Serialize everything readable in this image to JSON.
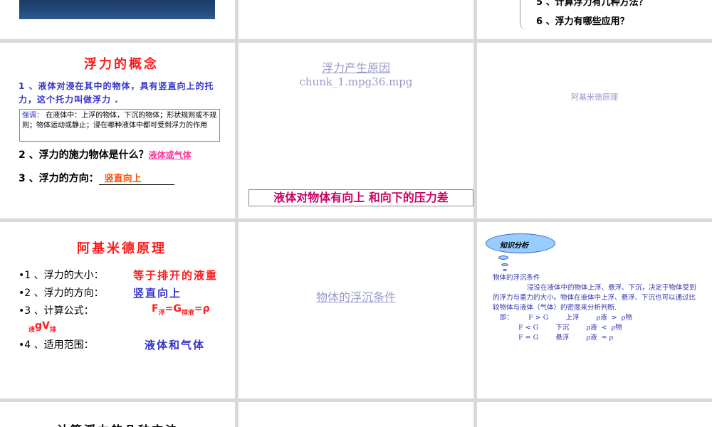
{
  "slide_top_right": {
    "q5": "5 、计算浮力有几种方法？",
    "q6": "6 、浮力有哪些应用？"
  },
  "slide_concept": {
    "title": "浮力的概念",
    "definition": "1 、液体对浸在其中的物体，具有竖直向上的托力，这个托力叫做浮力 .",
    "emphasis_tag": "强调：",
    "emphasis_text": "在液体中：上浮的物体，下沉的物体；形状规则或不规则；物体运动或静止；浸在哪种液体中都可受到浮力的作用",
    "q2": "2 、浮力的施力物体是什么？",
    "a2": "液体或气体",
    "q3": "3 、浮力的方向：",
    "a3": "竖直向上"
  },
  "slide_cause": {
    "link_title": "浮力产生原因",
    "link_file": "chunk_1.mpg36.mpg",
    "conclusion": "液体对物体有向上 和向下的压力差"
  },
  "slide_archimedes_link": {
    "link": "阿基米德原理"
  },
  "slide_archimedes": {
    "title": "阿基米德原理",
    "b1": "•1 、浮力的大小：",
    "a1": "等于排开的液重",
    "b2": "•2 、浮力的方向：",
    "a2": "竖直向上",
    "b3": "•3 、计算公式：",
    "formula_F": "F",
    "formula_sub_float": "浮",
    "formula_eq_G": "=G",
    "formula_sub_disp": "排液",
    "formula_eq_rho": "=ρ",
    "formula_sub_liquid": "液",
    "formula_gV": "gV",
    "formula_sub_pai": "排",
    "b4": "•4 、适用范围：",
    "a4": "液体和气体"
  },
  "slide_float_sink": {
    "link": "物体的浮沉条件"
  },
  "slide_knowledge": {
    "cloud_label": "知识分析",
    "heading": "物体的浮沉条件",
    "para": "浸没在液体中的物体上浮、悬浮、下沉，决定于物体受到的浮力与重力的大小。物体在液体中上浮、悬浮、下沉也可以通过比较物体与液体（气体）的密度来分析判断.",
    "row1": "即：       F > G        上浮        ρ液  >  ρ物",
    "row2": "F < G        下沉        ρ液  <  ρ物",
    "row3": "F = G        悬浮        ρ液  = ρ"
  },
  "slide_bottom_left": {
    "title": "计算浮力的几种方法"
  }
}
